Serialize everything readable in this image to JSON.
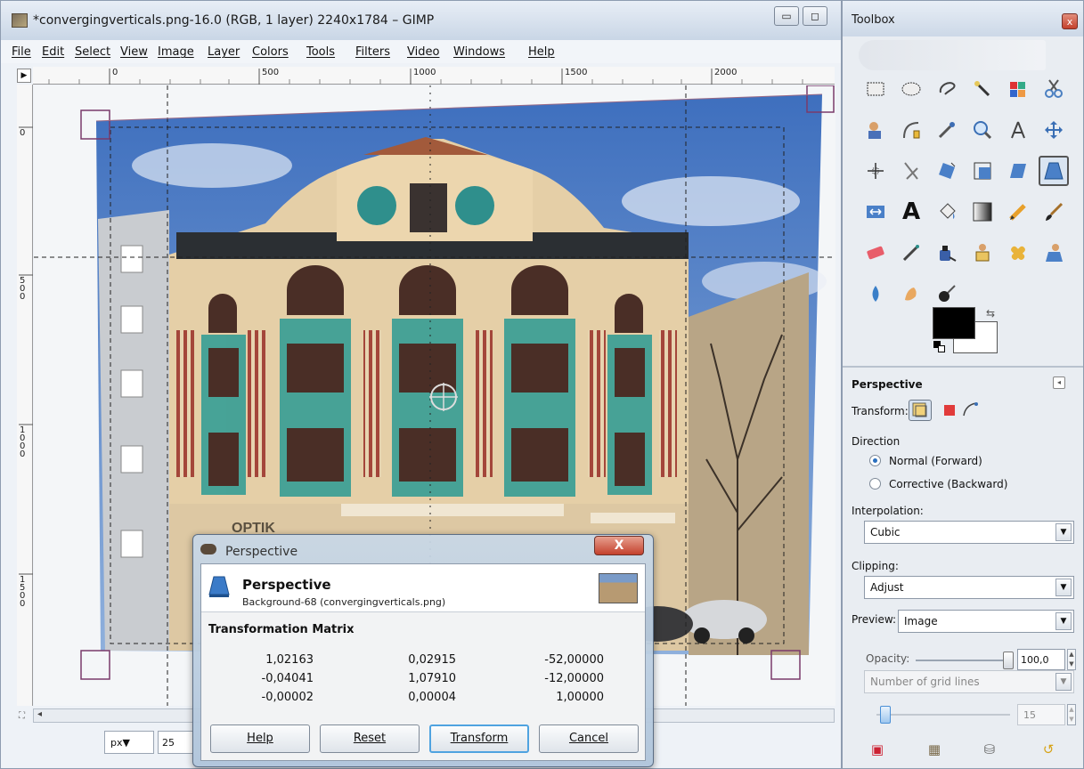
{
  "main_window": {
    "title": "*convergingverticals.png-16.0 (RGB, 1 layer) 2240x1784 – GIMP",
    "minimize_label": "▭",
    "maximize_label": "◻",
    "menu": [
      "File",
      "Edit",
      "Select",
      "View",
      "Image",
      "Layer",
      "Colors",
      "Tools",
      "Filters",
      "Video",
      "Windows",
      "Help"
    ],
    "ruler_h_labels": [
      "0",
      "500",
      "1000",
      "1500",
      "2000"
    ],
    "ruler_v_labels": [
      "0",
      "500",
      "1000",
      "1500"
    ],
    "ruler_corner": "▶",
    "status": {
      "unit": "px▼",
      "zoom": "25"
    },
    "canvas": {
      "sign_text": "OPTIK"
    }
  },
  "dialog": {
    "window_title": "Perspective",
    "close_label": "X",
    "heading": "Perspective",
    "subheading": "Background-68 (convergingverticals.png)",
    "matrix_title": "Transformation Matrix",
    "matrix": [
      [
        "1,02163",
        "0,02915",
        "-52,00000"
      ],
      [
        "-0,04041",
        "1,07910",
        "-12,00000"
      ],
      [
        "-0,00002",
        "0,00004",
        "1,00000"
      ]
    ],
    "buttons": {
      "help": "Help",
      "reset": "Reset",
      "transform": "Transform",
      "cancel": "Cancel"
    }
  },
  "toolbox": {
    "title": "Toolbox",
    "close_label": "x",
    "tools": [
      "rect-select",
      "ellipse-select",
      "free-select",
      "fuzzy-select",
      "color-select",
      "scissors",
      "foreground-select",
      "paths",
      "color-picker",
      "zoom",
      "measure",
      "move",
      "align",
      "crop",
      "rotate",
      "scale",
      "shear",
      "perspective",
      "flip",
      "text",
      "bucket-fill",
      "blend",
      "pencil",
      "paintbrush",
      "eraser",
      "airbrush",
      "ink",
      "clone",
      "heal",
      "perspective-clone",
      "blur",
      "smudge",
      "dodge-burn"
    ],
    "active_tool": "perspective",
    "colors": {
      "foreground": "#000000",
      "background": "#ffffff"
    },
    "options": {
      "title": "Perspective",
      "transform_label": "Transform:",
      "direction_label": "Direction",
      "direction_options": [
        "Normal (Forward)",
        "Corrective (Backward)"
      ],
      "direction_selected": "Normal (Forward)",
      "interpolation_label": "Interpolation:",
      "interpolation_value": "Cubic",
      "clipping_label": "Clipping:",
      "clipping_value": "Adjust",
      "preview_label": "Preview:",
      "preview_value": "Image",
      "opacity_label": "Opacity:",
      "opacity_value": "100,0",
      "guides_value": "Number of grid lines",
      "grid_lines_value": "15"
    }
  }
}
